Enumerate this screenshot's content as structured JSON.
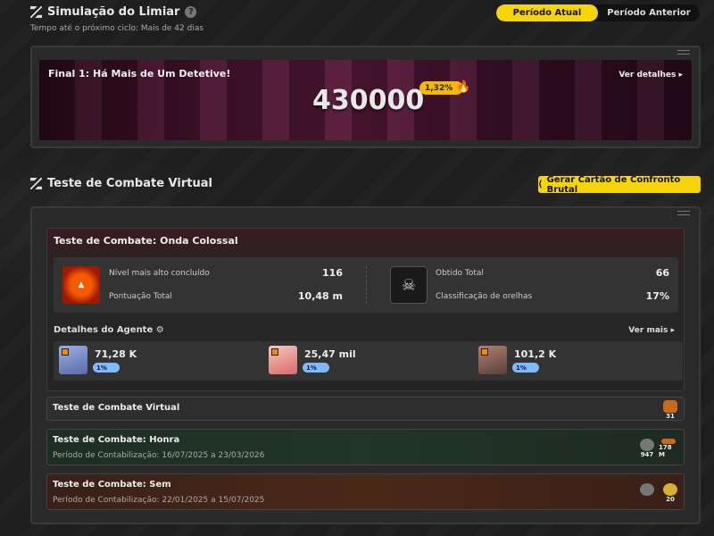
{
  "header": {
    "title": "Simulação do Limiar",
    "subtitle": "Tempo até o próximo ciclo: Mais de 42 dias"
  },
  "period_toggle": {
    "options": [
      "Período Atual",
      "Período Anterior"
    ],
    "selected": "Período Atual"
  },
  "hero": {
    "title": "Final 1: Há Mais de Um Detetive!",
    "score": "430000",
    "badge": "1,32%",
    "link": "Ver detalhes ▸"
  },
  "combat_section": {
    "title": "Teste de Combate Virtual",
    "generate_button": "Gerar Cartão de Confronto Brutal"
  },
  "colossal": {
    "title": "Teste de Combate: Onda Colossal",
    "stats_left": [
      {
        "label": "Nível mais alto concluído",
        "value": "116"
      },
      {
        "label": "Pontuação Total",
        "value": "10,48 m"
      }
    ],
    "stats_right": [
      {
        "label": "Obtido Total",
        "value": "66"
      },
      {
        "label": "Classificação de orelhas",
        "value": "17%"
      }
    ],
    "agents_label": "Detalhes do Agente ⚙",
    "agents_more": "Ver mais ▸",
    "agents": [
      {
        "value": "71,28 K",
        "pct": "1%"
      },
      {
        "value": "25,47 mil",
        "pct": "1%"
      },
      {
        "value": "101,2 K",
        "pct": "1%"
      }
    ]
  },
  "rows": [
    {
      "title": "Teste de Combate Virtual",
      "subtitle": "",
      "badges": [
        "31"
      ]
    },
    {
      "title": "Teste de Combate: Honra",
      "subtitle": "Período de Contabilização: 16/07/2025 a 23/03/2026",
      "badges": [
        "947",
        "178 M"
      ]
    },
    {
      "title": "Teste de Combate: Sem",
      "subtitle": "Período de Contabilização: 22/01/2025 a 15/07/2025",
      "badges": [
        "",
        "20"
      ]
    }
  ],
  "colors": {
    "accent": "#f5d50a",
    "background": "#1e1e1e",
    "panel": "#2a2a2a"
  }
}
